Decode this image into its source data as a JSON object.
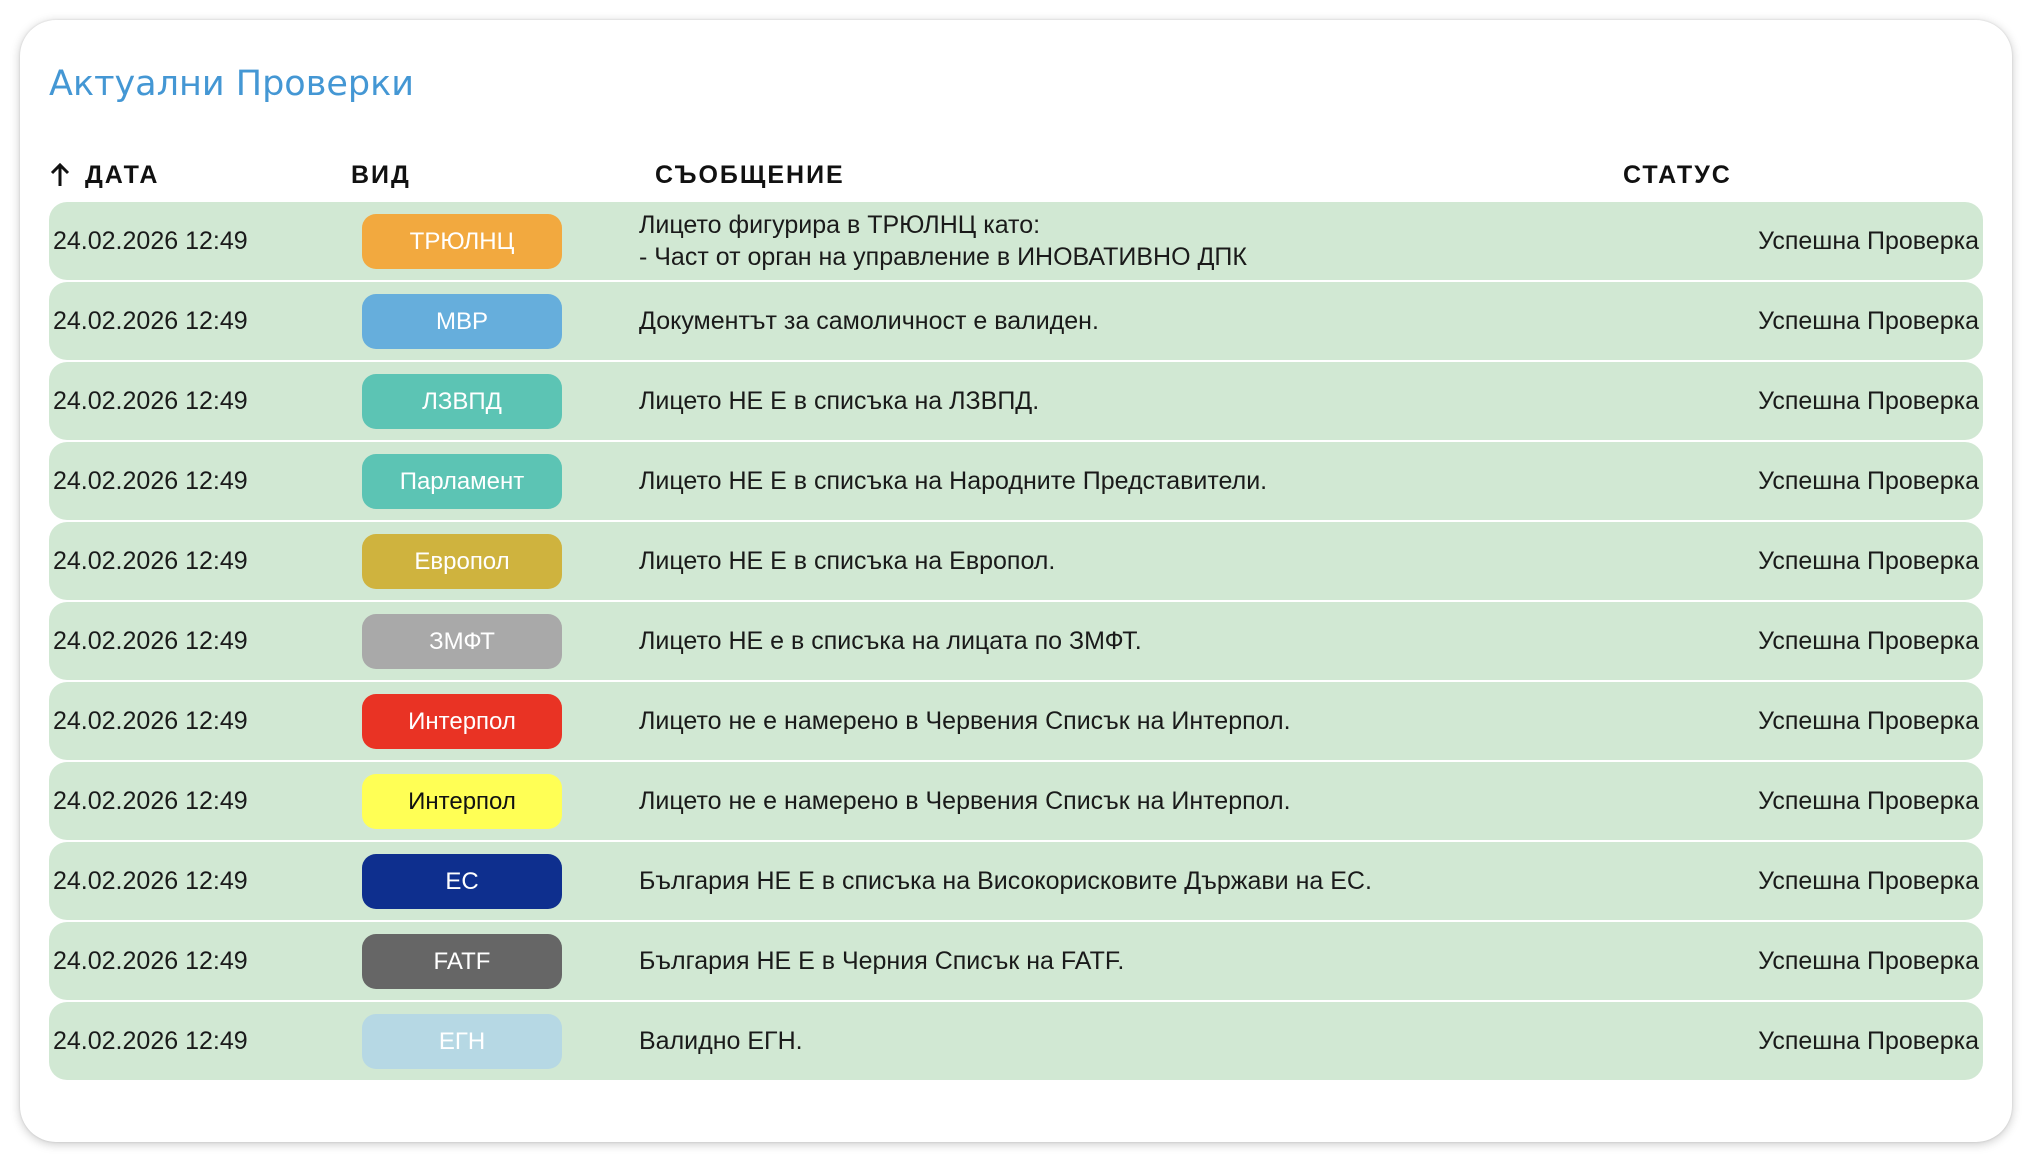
{
  "title": "Актуални Проверки",
  "columns": {
    "date": "ДАТА",
    "type": "ВИД",
    "message": "СЪОБЩЕНИЕ",
    "status": "СТАТУС"
  },
  "sort_icon": "arrow-up-icon",
  "colors": {
    "title": "#4497d4",
    "row_background": "#d1e8d3"
  },
  "rows": [
    {
      "date": "24.02.2026 12:49",
      "type": "ТРЮЛНЦ",
      "badge_color": "#f2a93f",
      "badge_text_color": "#ffffff",
      "message": "Лицето фигурира в ТРЮЛНЦ като:",
      "message_line2": "- Част от орган на управление в ИНОВАТИВНО ДПК",
      "status": "Успешна Проверка"
    },
    {
      "date": "24.02.2026 12:49",
      "type": "МВР",
      "badge_color": "#66aedc",
      "badge_text_color": "#ffffff",
      "message": "Документът за самоличност е валиден.",
      "status": "Успешна Проверка"
    },
    {
      "date": "24.02.2026 12:49",
      "type": "ЛЗВПД",
      "badge_color": "#5cc4b4",
      "badge_text_color": "#ffffff",
      "message": "Лицето НЕ Е в списъка на ЛЗВПД.",
      "status": "Успешна Проверка"
    },
    {
      "date": "24.02.2026 12:49",
      "type": "Парламент",
      "badge_color": "#5cc4b4",
      "badge_text_color": "#ffffff",
      "message": "Лицето НЕ Е в списъка на Народните Представители.",
      "status": "Успешна Проверка"
    },
    {
      "date": "24.02.2026 12:49",
      "type": "Европол",
      "badge_color": "#cfb33e",
      "badge_text_color": "#ffffff",
      "message": "Лицето НЕ Е в списъка на Европол.",
      "status": "Успешна Проверка"
    },
    {
      "date": "24.02.2026 12:49",
      "type": "ЗМФТ",
      "badge_color": "#a9a9a9",
      "badge_text_color": "#ffffff",
      "message": "Лицето НЕ е в списъка на лицата по ЗМФТ.",
      "status": "Успешна Проверка"
    },
    {
      "date": "24.02.2026 12:49",
      "type": "Интерпол",
      "badge_color": "#e93324",
      "badge_text_color": "#ffffff",
      "message": "Лицето не е намерено в Червения Списък на Интерпол.",
      "status": "Успешна Проверка"
    },
    {
      "date": "24.02.2026 12:49",
      "type": "Интерпол",
      "badge_color": "#ffff55",
      "badge_text_color": "#111111",
      "message": "Лицето не е намерено в Червения Списък на Интерпол.",
      "status": "Успешна Проверка"
    },
    {
      "date": "24.02.2026 12:49",
      "type": "ЕС",
      "badge_color": "#0e2f8e",
      "badge_text_color": "#ffffff",
      "message": "България НЕ Е в списъка на Високорисковите Държави на ЕС.",
      "status": "Успешна Проверка"
    },
    {
      "date": "24.02.2026 12:49",
      "type": "FATF",
      "badge_color": "#666666",
      "badge_text_color": "#ffffff",
      "message": "България НЕ Е в Черния Списък на FATF.",
      "status": "Успешна Проверка"
    },
    {
      "date": "24.02.2026 12:49",
      "type": "ЕГН",
      "badge_color": "#b6d8e4",
      "badge_text_color": "#ffffff",
      "message": "Валидно ЕГН.",
      "status": "Успешна Проверка"
    }
  ]
}
